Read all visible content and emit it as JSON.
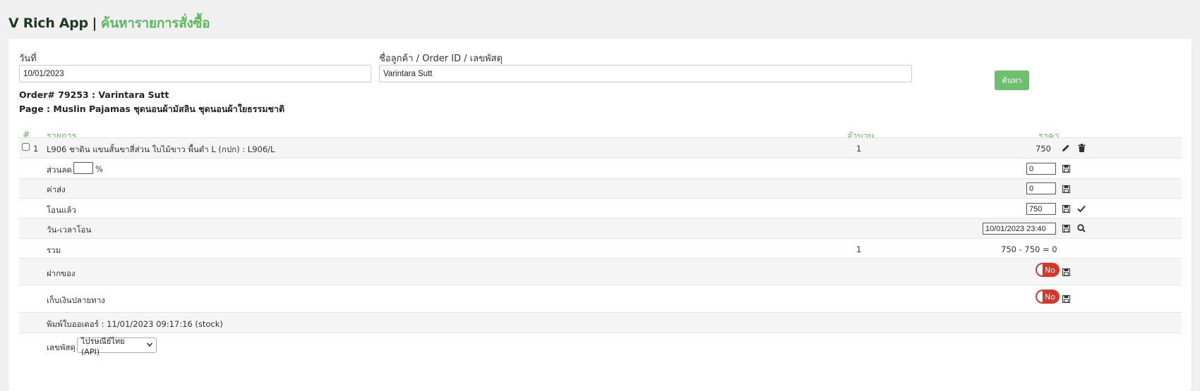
{
  "header": {
    "app_name": "V Rich App",
    "separator": "|",
    "page_title": "ค้นหารายการสั่งซื้อ"
  },
  "search": {
    "date_label": "วันที่",
    "date_value": "10/01/2023",
    "query_label": "ชื่อลูกค้า / Order ID / เลขพัสดุ",
    "query_value": "Varintara Sutt",
    "search_button": "ค้นหา"
  },
  "order": {
    "title": "Order# 79253 : Varintara Sutt",
    "page_line": "Page : Muslin Pajamas ชุดนอนผ้ามัสลิน ชุดนอนผ้าใยธรรมชาติ"
  },
  "table": {
    "headers": {
      "index": "#",
      "item": "รายการ",
      "qty": "จำนวน",
      "price": "ราคา"
    },
    "item": {
      "index": "1",
      "name": "L906 ชาดิน แขนสั้นขาสี่ส่วน ใบไม้ขาว พื้นดำ L (กปก) : L906/L",
      "qty": "1",
      "price": "750"
    },
    "discount": {
      "label": "ส่วนลด",
      "percent_value": "",
      "percent_sign": "%",
      "value": "0"
    },
    "shipping": {
      "label": "ค่าส่ง",
      "value": "0"
    },
    "paid": {
      "label": "โอนแล้ว",
      "value": "750"
    },
    "transfer_time": {
      "label": "วัน-เวลาโอน",
      "value": "10/01/2023 23:40"
    },
    "total": {
      "label": "รวม",
      "qty": "1",
      "summary": "750 - 750 = 0"
    },
    "deposit": {
      "label": "ฝากของ",
      "toggle": "No"
    },
    "cod": {
      "label": "เก็บเงินปลายทาง",
      "toggle": "No"
    },
    "printed": {
      "text": "พิมพ์ใบออเดอร์ : 11/01/2023 09:17:16 (stock)"
    },
    "tracking": {
      "label": "เลขพัสดุ",
      "carrier": "ไปรษณีย์ไทย (API)"
    }
  },
  "colors": {
    "accent": "#5cb85c",
    "button": "#6cc070",
    "toggle_off": "#d9362b"
  }
}
